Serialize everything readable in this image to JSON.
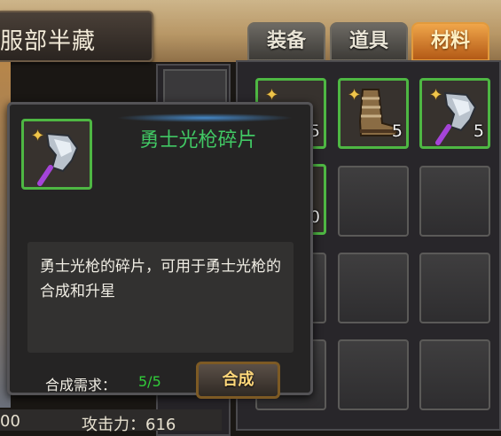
{
  "character": {
    "name": "服部半藏"
  },
  "tabs": [
    {
      "label": "装备",
      "active": false
    },
    {
      "label": "道具",
      "active": false
    },
    {
      "label": "材料",
      "active": true
    }
  ],
  "inventory": {
    "items": [
      {
        "icon": "lance-fragment-icon",
        "count": "5",
        "star": true
      },
      {
        "icon": "boots-icon",
        "count": "5",
        "star": true
      },
      {
        "icon": "lance-fragment-icon",
        "count": "5",
        "star": true
      },
      {
        "icon": "unknown-item-icon",
        "count": "0",
        "star": false
      }
    ]
  },
  "tooltip": {
    "title": "勇士光枪碎片",
    "description": "勇士光枪的碎片，可用于勇士光枪的合成和升星",
    "requirement_label": "合成需求：",
    "requirement_value": "5/5",
    "button_label": "合成"
  },
  "stats": {
    "left_value": "00",
    "attack_label": "攻击力：616"
  },
  "colors": {
    "active_tab": "#e8943a",
    "item_border": "#4eb743",
    "title_green": "#41c864",
    "count_green": "#31cc3a"
  }
}
